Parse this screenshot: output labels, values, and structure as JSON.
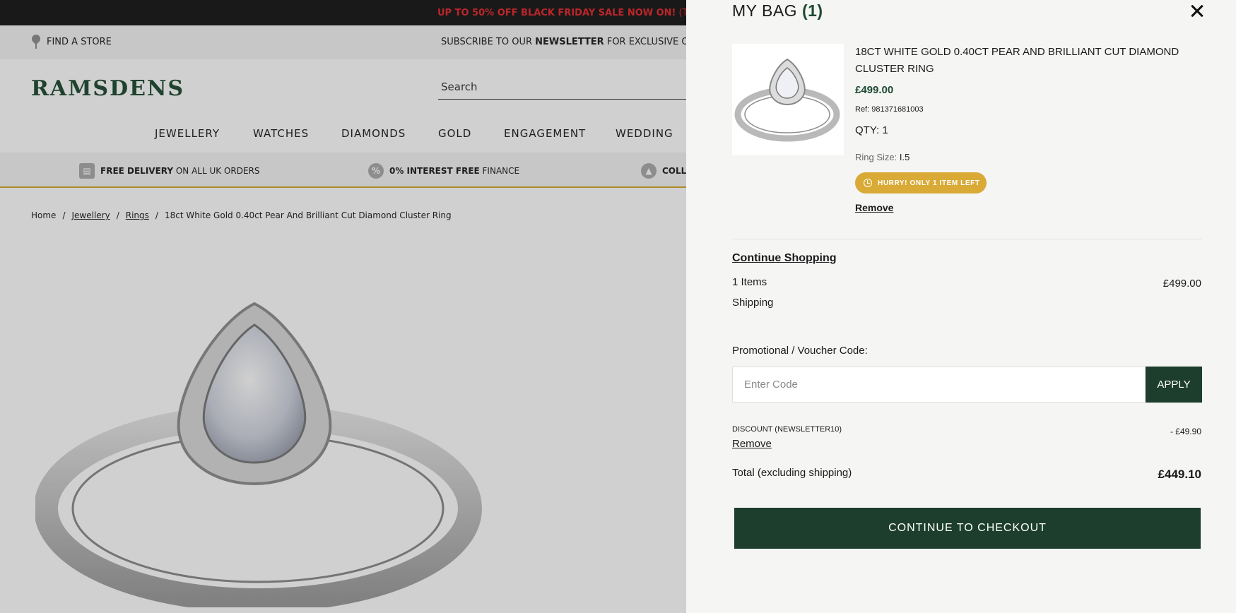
{
  "promo_bar": {
    "text": "UP TO 50% OFF BLACK FRIDAY SALE NOW ON!",
    "terms": "(T&Cs A"
  },
  "utility": {
    "find_store": "FIND A STORE",
    "newsletter_pre": "SUBSCRIBE TO OUR ",
    "newsletter_bold": "NEWSLETTER",
    "newsletter_post": " FOR EXCLUSIVE OF"
  },
  "header": {
    "logo": "RAMSDENS",
    "search_placeholder": "Search"
  },
  "nav": {
    "items": [
      "JEWELLERY",
      "WATCHES",
      "DIAMONDS",
      "GOLD",
      "ENGAGEMENT",
      "WEDDING"
    ]
  },
  "usp": {
    "delivery_bold": "FREE DELIVERY",
    "delivery_rest": " ON ALL UK ORDERS",
    "finance_bold": "0% INTEREST FREE",
    "finance_rest": " FINANCE",
    "collect": "COLL"
  },
  "breadcrumb": {
    "home": "Home",
    "jewellery": "Jewellery",
    "rings": "Rings",
    "current": "18ct White Gold 0.40ct Pear And Brilliant Cut Diamond Cluster Ring"
  },
  "bag": {
    "title": "MY BAG",
    "count": "(1)",
    "item": {
      "name": "18CT WHITE GOLD 0.40CT PEAR AND BRILLIANT CUT DIAMOND CLUSTER RING",
      "price": "£499.00",
      "ref_label": "Ref: ",
      "ref": "981371681003",
      "qty": "QTY: 1",
      "ring_size_label": "Ring Size: ",
      "ring_size": "I.5",
      "badge": "HURRY! ONLY 1 ITEM LEFT",
      "remove": "Remove"
    },
    "continue_shopping": "Continue Shopping",
    "items_label": "1 Items",
    "items_value": "£499.00",
    "shipping_label": "Shipping",
    "promo_label": "Promotional / Voucher Code:",
    "promo_placeholder": "Enter Code",
    "apply": "APPLY",
    "discount_label": "DISCOUNT (NEWSLETTER10)",
    "discount_value": "- £49.90",
    "discount_remove": "Remove",
    "total_label": "Total (excluding shipping)",
    "total_value": "£449.10",
    "checkout": "CONTINUE TO CHECKOUT"
  },
  "colors": {
    "brand_green": "#1d3e2c",
    "price_green": "#1d4a31",
    "badge_gold": "#d9aa36",
    "promo_red": "#e3262c"
  }
}
